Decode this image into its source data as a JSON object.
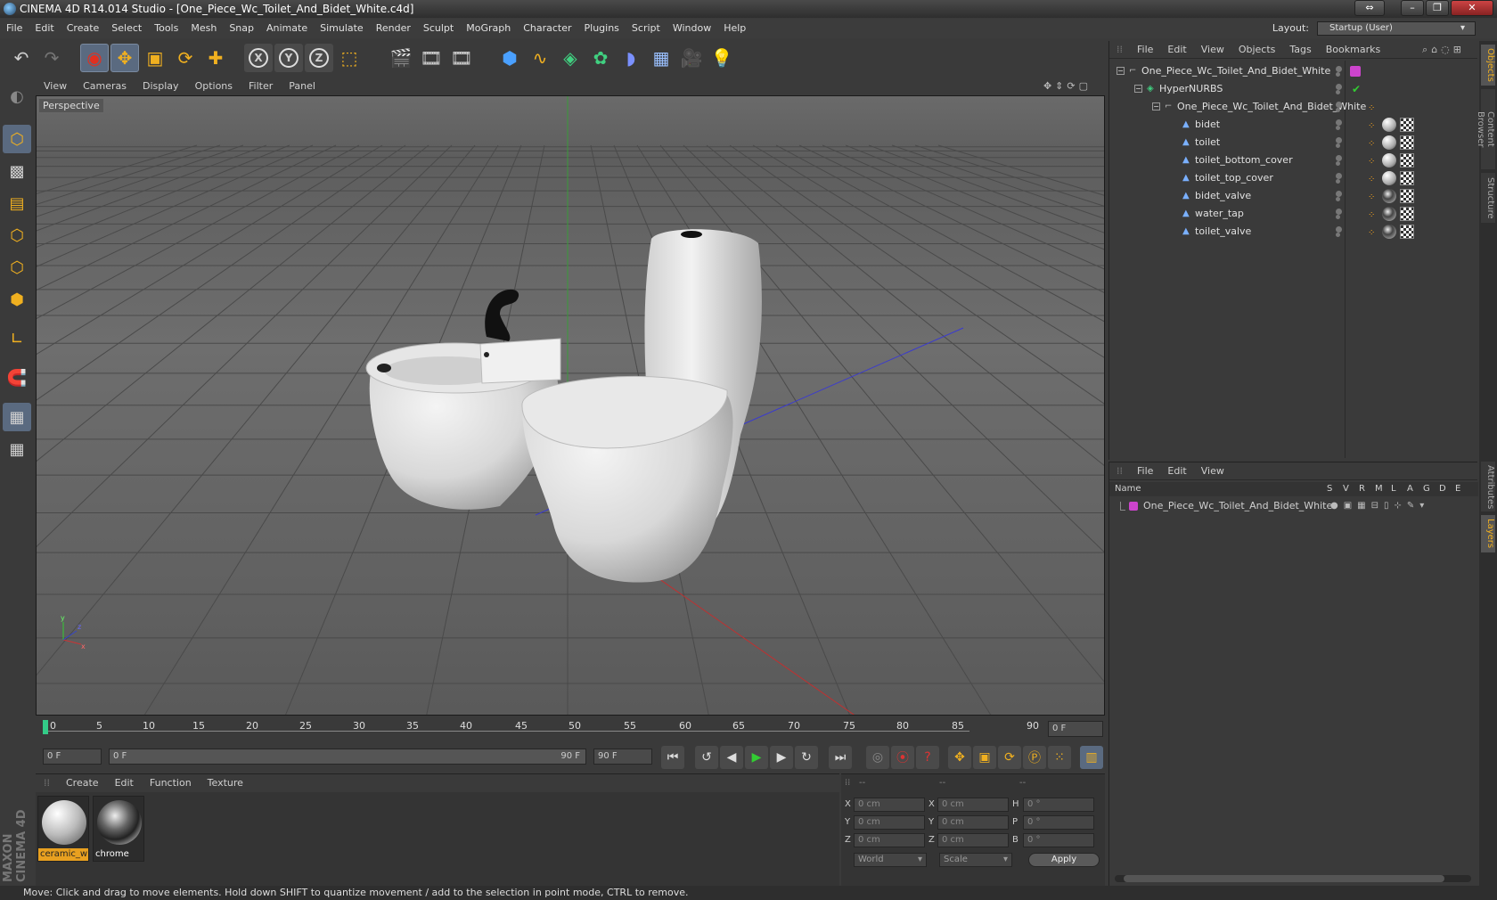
{
  "window": {
    "title": "CINEMA 4D R14.014 Studio - [One_Piece_Wc_Toilet_And_Bidet_White.c4d]",
    "layout_label": "Layout:",
    "layout_value": "Startup (User)"
  },
  "menu": [
    "File",
    "Edit",
    "Create",
    "Select",
    "Tools",
    "Mesh",
    "Snap",
    "Animate",
    "Simulate",
    "Render",
    "Sculpt",
    "MoGraph",
    "Character",
    "Plugins",
    "Script",
    "Window",
    "Help"
  ],
  "toolbar": {
    "axis_x": "X",
    "axis_y": "Y",
    "axis_z": "Z"
  },
  "viewport": {
    "menu": [
      "View",
      "Cameras",
      "Display",
      "Options",
      "Filter",
      "Panel"
    ],
    "label": "Perspective"
  },
  "timeline": {
    "ticks": [
      "0",
      "5",
      "10",
      "15",
      "20",
      "25",
      "30",
      "35",
      "40",
      "45",
      "50",
      "55",
      "60",
      "65",
      "70",
      "75",
      "80",
      "85",
      "90"
    ],
    "current_frame": "0 F",
    "start_field": "0 F",
    "range_start": "0 F",
    "range_end": "90 F",
    "end_field": "90 F"
  },
  "materials": {
    "menu": [
      "Create",
      "Edit",
      "Function",
      "Texture"
    ],
    "items": [
      {
        "name": "ceramic_w",
        "selected": true
      },
      {
        "name": "chrome",
        "selected": false
      }
    ]
  },
  "coords": {
    "header": [
      "--",
      "--",
      "--"
    ],
    "rows": [
      {
        "a": "X",
        "av": "0 cm",
        "b": "X",
        "bv": "0 cm",
        "c": "H",
        "cv": "0 °"
      },
      {
        "a": "Y",
        "av": "0 cm",
        "b": "Y",
        "bv": "0 cm",
        "c": "P",
        "cv": "0 °"
      },
      {
        "a": "Z",
        "av": "0 cm",
        "b": "Z",
        "bv": "0 cm",
        "c": "B",
        "cv": "0 °"
      }
    ],
    "mode1": "World",
    "mode2": "Scale",
    "apply": "Apply"
  },
  "objects": {
    "menu": [
      "File",
      "Edit",
      "View",
      "Objects",
      "Tags",
      "Bookmarks"
    ],
    "rows": [
      {
        "name": "One_Piece_Wc_Toilet_And_Bidet_White",
        "indent": 0,
        "icon": "null-object-icon",
        "tags": "layer"
      },
      {
        "name": "HyperNURBS",
        "indent": 1,
        "icon": "hypernurbs-icon",
        "tags": "check"
      },
      {
        "name": "One_Piece_Wc_Toilet_And_Bidet_White",
        "indent": 2,
        "icon": "null-object-icon",
        "tags": "dot"
      },
      {
        "name": "bidet",
        "indent": 3,
        "icon": "polygon-object-icon",
        "tags": "ceramic"
      },
      {
        "name": "toilet",
        "indent": 3,
        "icon": "polygon-object-icon",
        "tags": "ceramic"
      },
      {
        "name": "toilet_bottom_cover",
        "indent": 3,
        "icon": "polygon-object-icon",
        "tags": "ceramic"
      },
      {
        "name": "toilet_top_cover",
        "indent": 3,
        "icon": "polygon-object-icon",
        "tags": "ceramic"
      },
      {
        "name": "bidet_valve",
        "indent": 3,
        "icon": "polygon-object-icon",
        "tags": "chrome"
      },
      {
        "name": "water_tap",
        "indent": 3,
        "icon": "polygon-object-icon",
        "tags": "chrome"
      },
      {
        "name": "toilet_valve",
        "indent": 3,
        "icon": "polygon-object-icon",
        "tags": "chrome"
      }
    ]
  },
  "layers": {
    "menu": [
      "File",
      "Edit",
      "View"
    ],
    "name_header": "Name",
    "cols": [
      "S",
      "V",
      "R",
      "M",
      "L",
      "A",
      "G",
      "D",
      "E"
    ],
    "rows": [
      {
        "name": "One_Piece_Wc_Toilet_And_Bidet_White",
        "color": "#cc44cc"
      }
    ]
  },
  "side_tabs": [
    "Objects",
    "Content Browser",
    "Structure",
    "Attributes",
    "Layers"
  ],
  "brand": {
    "line1": "MAXON",
    "line2": "CINEMA 4D"
  },
  "status": "Move: Click and drag to move elements. Hold down SHIFT to quantize movement / add to the selection in point mode, CTRL to remove.",
  "colors": {
    "accent": "#5a6a80",
    "layer": "#cc44cc",
    "selected_material": "#e8a020",
    "y_axis": "#33cc33",
    "x_axis": "#cc3333",
    "z_axis": "#3344cc"
  }
}
